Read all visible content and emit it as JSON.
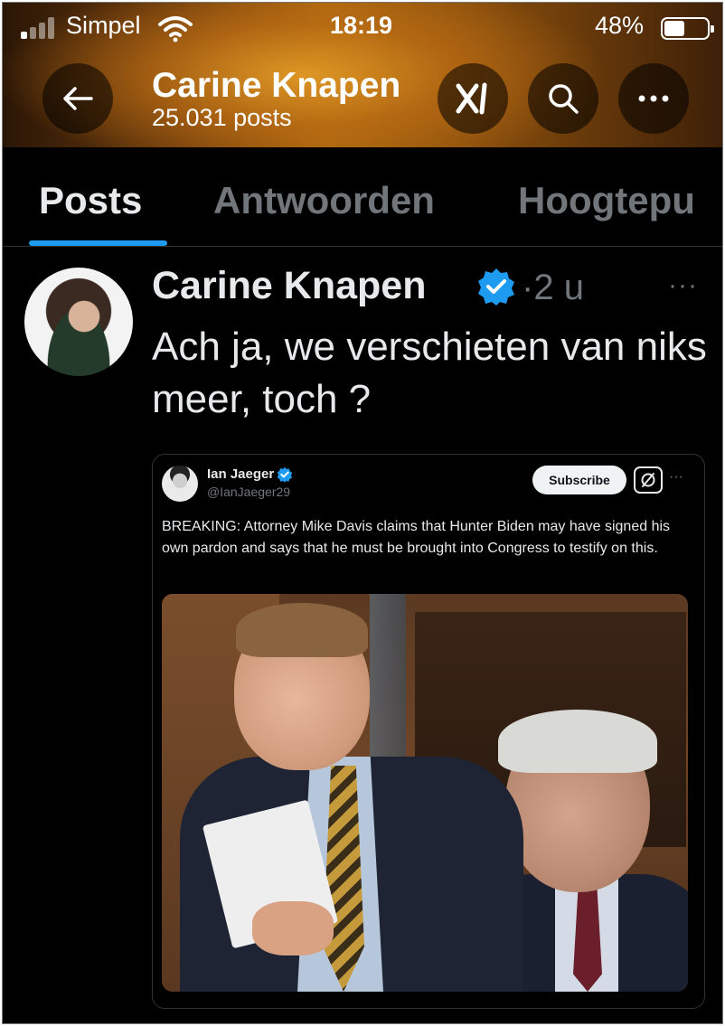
{
  "status_bar": {
    "carrier": "Simpel",
    "time": "18:19",
    "battery": "48%",
    "battery_level": 0.48
  },
  "header": {
    "back_icon": "arrow-left-icon",
    "name": "Carine Knapen",
    "post_count": "25.031 posts",
    "grok_icon": "grok-icon",
    "search_icon": "search-icon",
    "more_icon": "more-horizontal-icon"
  },
  "tabs": [
    {
      "label": "Posts",
      "active": true
    },
    {
      "label": "Antwoorden",
      "active": false
    },
    {
      "label": "Hoogtepu",
      "active": false
    }
  ],
  "post": {
    "author": "Carine Knapen",
    "separator": "·",
    "time": "2 u",
    "more": "···",
    "text": "Ach ja, we verschieten van niks meer, toch ?",
    "accent": "#1d9bf0"
  },
  "embed": {
    "name": "Ian Jaeger",
    "handle": "@IanJaeger29",
    "subscribe_label": "Subscribe",
    "more": "···",
    "text": "BREAKING: Attorney Mike Davis claims that Hunter Biden may have signed his own pardon and says that he must be brought into Congress to testify on this."
  }
}
